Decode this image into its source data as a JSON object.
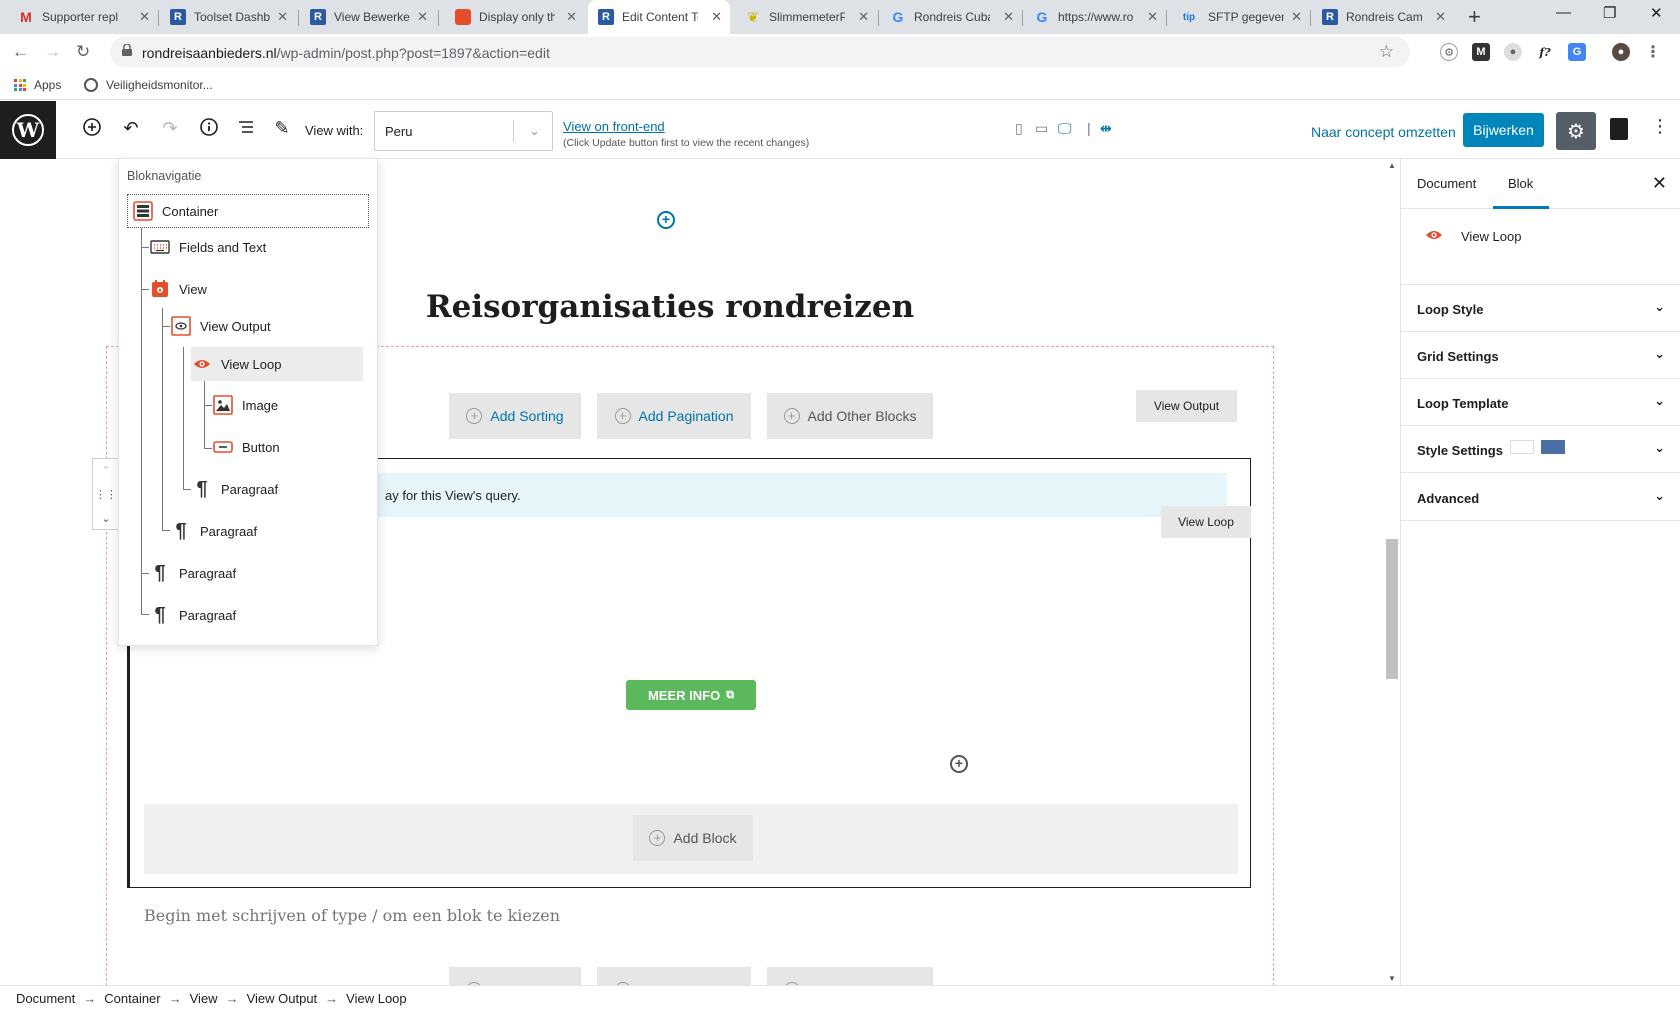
{
  "browser": {
    "tabs": [
      {
        "title": "Supporter repl",
        "favicon": "gmail-icon",
        "color": "#d93025",
        "glyph": "M"
      },
      {
        "title": "Toolset Dashbo",
        "favicon": "r-icon",
        "color": "#2c5aa0",
        "glyph": "R"
      },
      {
        "title": "View Bewerken",
        "favicon": "r-icon",
        "color": "#2c5aa0",
        "glyph": "R"
      },
      {
        "title": "Display only th",
        "favicon": "toolset-icon",
        "color": "#e54e2c",
        "glyph": ""
      },
      {
        "title": "Edit Content Te",
        "favicon": "r-icon",
        "color": "#2c5aa0",
        "glyph": "R",
        "active": true
      },
      {
        "title": "SlimmemeterPo",
        "favicon": "leaf-icon",
        "color": "#c9b200",
        "glyph": ""
      },
      {
        "title": "Rondreis Cuba",
        "favicon": "google-icon",
        "color": "#4285f4",
        "glyph": "G"
      },
      {
        "title": "https://www.ro",
        "favicon": "google-icon",
        "color": "#4285f4",
        "glyph": "G"
      },
      {
        "title": "SFTP gegevens",
        "favicon": "tip-icon",
        "color": "#1a73e8",
        "glyph": "tip"
      },
      {
        "title": "Rondreis Camb",
        "favicon": "r-icon",
        "color": "#2c5aa0",
        "glyph": "R"
      }
    ],
    "url_host": "rondreisaanbieders.nl",
    "url_path": "/wp-admin/post.php?post=1897&action=edit",
    "bookmarks": {
      "apps": "Apps",
      "item1": "Veiligheidsmonitor..."
    }
  },
  "editor": {
    "view_with_label": "View with:",
    "view_with_value": "Peru",
    "front_end_link": "View on front-end",
    "front_end_hint": "(Click Update button first to view the recent changes)",
    "draft_label": "Naar concept omzetten",
    "update_label": "Bijwerken"
  },
  "canvas": {
    "heading": "Reisorganisaties rondreizen",
    "add_sorting": "Add Sorting",
    "add_pagination": "Add Pagination",
    "add_other_blocks": "Add Other Blocks",
    "view_output_tag": "View Output",
    "view_loop_tag": "View Loop",
    "notice_text": "ay for this View's query.",
    "meer_info": "MEER INFO",
    "add_block": "Add Block",
    "placeholder": "Begin met schrijven of type / om een blok te kiezen"
  },
  "block_nav": {
    "title": "Bloknavigatie",
    "items": [
      {
        "label": "Container",
        "icon": "container-icon"
      },
      {
        "label": "Fields and Text",
        "icon": "keyboard-icon"
      },
      {
        "label": "View",
        "icon": "view-icon"
      },
      {
        "label": "View Output",
        "icon": "view-output-icon"
      },
      {
        "label": "View Loop",
        "icon": "eye-icon"
      },
      {
        "label": "Image",
        "icon": "image-icon"
      },
      {
        "label": "Button",
        "icon": "button-icon"
      },
      {
        "label": "Paragraaf",
        "icon": "pilcrow-icon"
      },
      {
        "label": "Paragraaf",
        "icon": "pilcrow-icon"
      },
      {
        "label": "Paragraaf",
        "icon": "pilcrow-icon"
      },
      {
        "label": "Paragraaf",
        "icon": "pilcrow-icon"
      }
    ]
  },
  "sidebar": {
    "tab_document": "Document",
    "tab_blok": "Blok",
    "block_name": "View Loop",
    "panels": [
      "Loop Style",
      "Grid Settings",
      "Loop Template",
      "Style Settings",
      "Advanced"
    ],
    "swatch_colors": [
      "#ffffff",
      "#4a6fa5"
    ]
  },
  "breadcrumb": [
    "Document",
    "Container",
    "View",
    "View Output",
    "View Loop"
  ],
  "colors": {
    "accent": "#0085ba",
    "toolset_orange": "#e54e2c",
    "link": "#0073aa",
    "success": "#5cb85c"
  }
}
